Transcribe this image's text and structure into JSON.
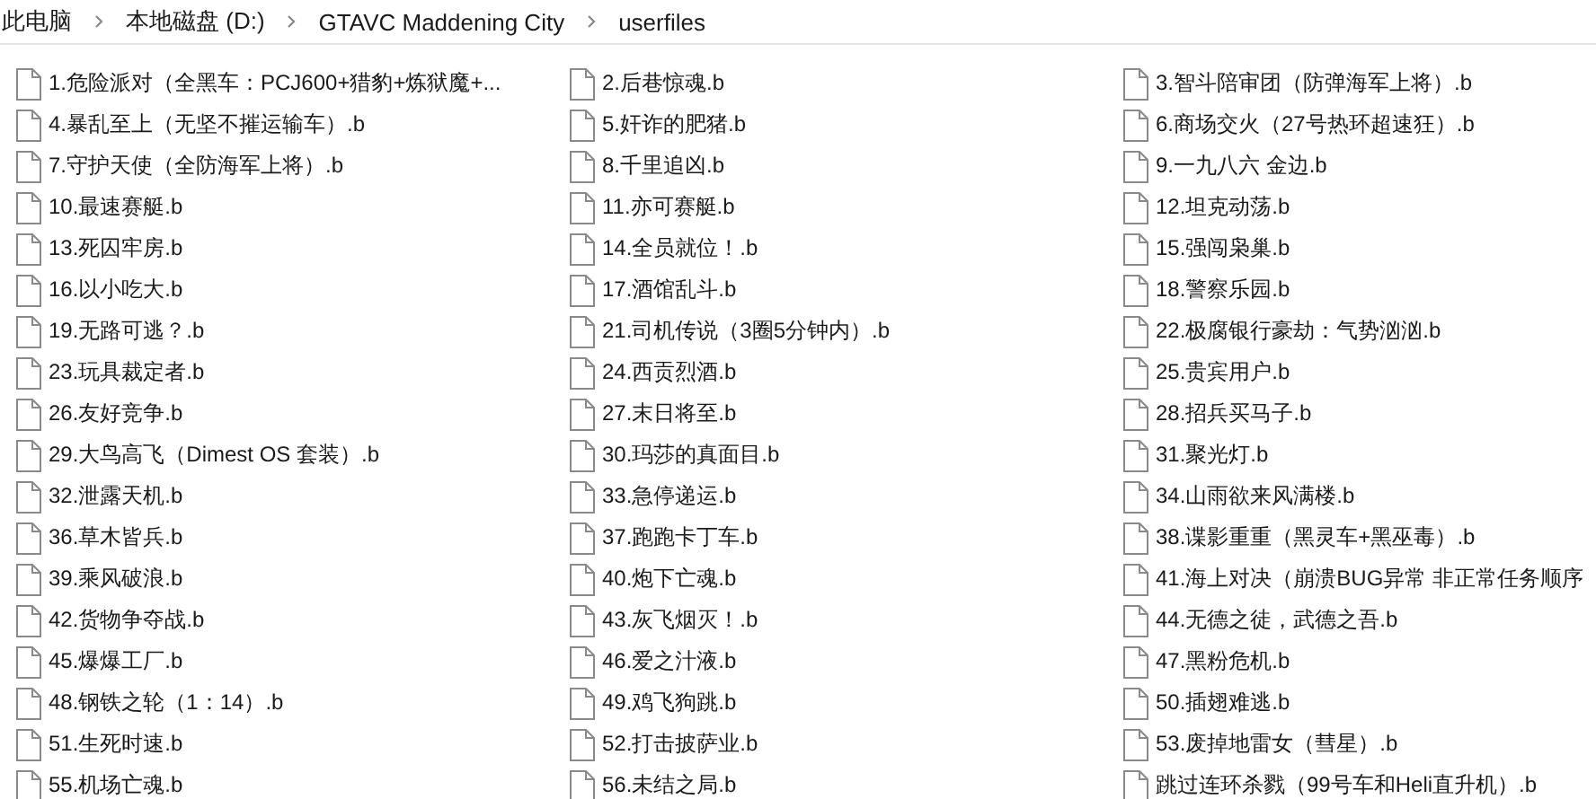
{
  "breadcrumb": [
    "此电脑",
    "本地磁盘 (D:)",
    "GTAVC Maddening City",
    "userfiles"
  ],
  "files": [
    "1.危险派对（全黑车：PCJ600+猎豹+炼狱魔+...",
    "2.后巷惊魂.b",
    "3.智斗陪审团（防弹海军上将）.b",
    "4.暴乱至上（无坚不摧运输车）.b",
    "5.奸诈的肥猪.b",
    "6.商场交火（27号热环超速狂）.b",
    "7.守护天使（全防海军上将）.b",
    "8.千里追凶.b",
    "9.一九八六 金边.b",
    "10.最速赛艇.b",
    "11.亦可赛艇.b",
    "12.坦克动荡.b",
    "13.死囚牢房.b",
    "14.全员就位！.b",
    "15.强闯枭巢.b",
    "16.以小吃大.b",
    "17.酒馆乱斗.b",
    "18.警察乐园.b",
    "19.无路可逃？.b",
    "21.司机传说（3圈5分钟内）.b",
    "22.极腐银行豪劫：气势汹汹.b",
    "23.玩具裁定者.b",
    "24.西贡烈酒.b",
    "25.贵宾用户.b",
    "26.友好竞争.b",
    "27.末日将至.b",
    "28.招兵买马子.b",
    "29.大鸟高飞（Dimest OS 套装）.b",
    "30.玛莎的真面目.b",
    "31.聚光灯.b",
    "32.泄露天机.b",
    "33.急停递运.b",
    "34.山雨欲来风满楼.b",
    "36.草木皆兵.b",
    "37.跑跑卡丁车.b",
    "38.谍影重重（黑灵车+黑巫毒）.b",
    "39.乘风破浪.b",
    "40.炮下亡魂.b",
    "41.海上对决（崩溃BUG异常 非正常任务顺序",
    "42.货物争夺战.b",
    "43.灰飞烟灭！.b",
    "44.无德之徒，武德之吾.b",
    "45.爆爆工厂.b",
    "46.爱之汁液.b",
    "47.黑粉危机.b",
    "48.钢铁之轮（1：14）.b",
    "49.鸡飞狗跳.b",
    "50.插翅难逃.b",
    "51.生死时速.b",
    "52.打击披萨业.b",
    "53.废掉地雷女（彗星）.b",
    "55.机场亡魂.b",
    "56.未结之局.b",
    "跳过连环杀戮（99号车和Heli直升机）.b"
  ]
}
